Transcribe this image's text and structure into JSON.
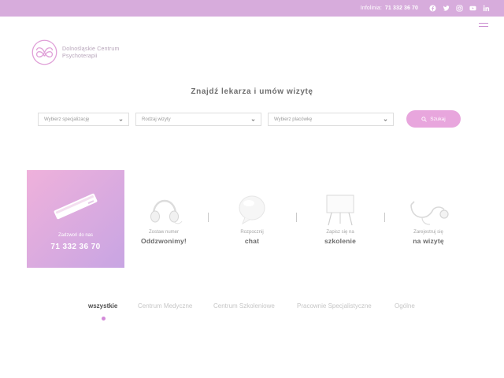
{
  "topbar": {
    "hotline_label": "Infolinia:",
    "hotline_number": "71 332 36 70",
    "social_icons": [
      "facebook-icon",
      "twitter-icon",
      "instagram-icon",
      "youtube-icon",
      "linkedin-icon"
    ],
    "background_color": "#d7acdc"
  },
  "logo": {
    "line1": "Dolnośląskie Centrum",
    "line2": "Psychoterapii",
    "color": "#e0a0d8"
  },
  "search": {
    "title": "Znajdź lekarza i umów wizytę",
    "specialization_placeholder": "Wybierz specjalizację",
    "visit_type_placeholder": "Rodzaj wizyty",
    "facility_placeholder": "Wybierz placówkę",
    "button_label": "Szukaj",
    "button_color": "#e8a6dd"
  },
  "call_card": {
    "caption": "Zadzwoń do nas",
    "number": "71 332 36 70"
  },
  "features": [
    {
      "icon": "headphones-icon",
      "small": "Zostaw numer",
      "big": "Oddzwonimy!"
    },
    {
      "icon": "chat-bubble-icon",
      "small": "Rozpocznij",
      "big": "chat"
    },
    {
      "icon": "whiteboard-icon",
      "small": "Zapisz się na",
      "big": "szkolenie"
    },
    {
      "icon": "stethoscope-icon",
      "small": "Zarejestruj się",
      "big": "na wizytę"
    }
  ],
  "tabs": [
    {
      "label": "wszystkie",
      "active": true
    },
    {
      "label": "Centrum Medyczne",
      "active": false
    },
    {
      "label": "Centrum Szkoleniowe",
      "active": false
    },
    {
      "label": "Pracownie Specjalistyczne",
      "active": false
    },
    {
      "label": "Ogólne",
      "active": false
    }
  ],
  "accent_color": "#d38ad9"
}
